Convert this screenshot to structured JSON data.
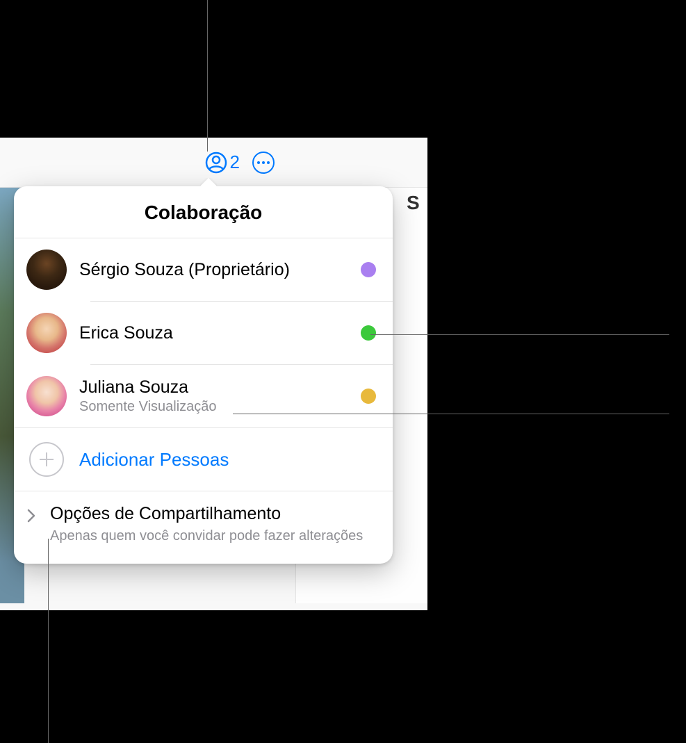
{
  "toolbar": {
    "collab_count": "2"
  },
  "right_letter": "S",
  "popover": {
    "title": "Colaboração",
    "participants": [
      {
        "name": "Sérgio Souza (Proprietário)",
        "sub": "",
        "dot": "#a97ff0"
      },
      {
        "name": "Erica Souza",
        "sub": "",
        "dot": "#3cc93c"
      },
      {
        "name": "Juliana Souza",
        "sub": "Somente Visualização",
        "dot": "#e8b93c"
      }
    ],
    "add_label": "Adicionar Pessoas",
    "options": {
      "title": "Opções de Compartilhamento",
      "sub": "Apenas quem você convidar pode fazer alterações"
    }
  }
}
